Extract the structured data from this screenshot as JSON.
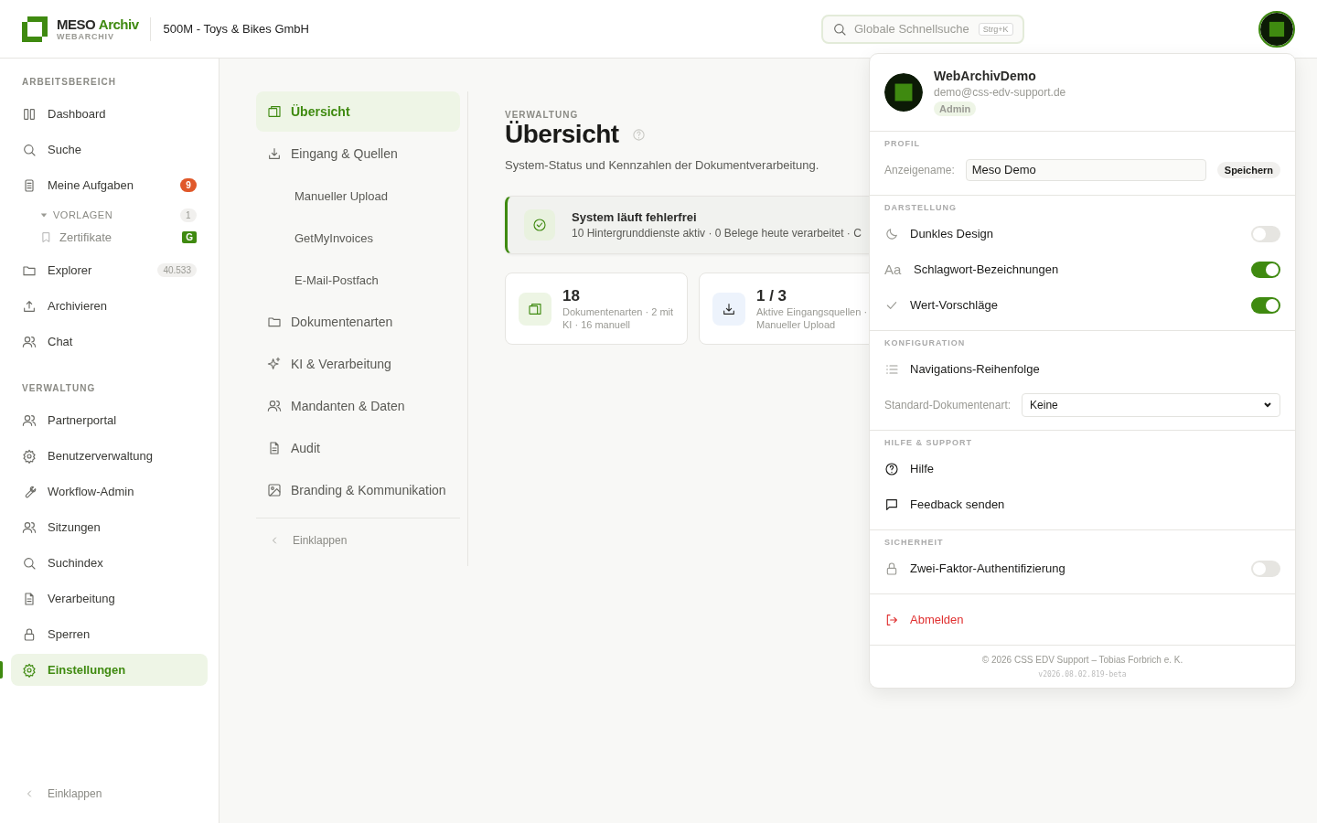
{
  "header": {
    "brand": {
      "primary": "MESO",
      "accent": "Archiv",
      "tagline": "WEBARCHIV"
    },
    "tenant": "500M - Toys & Bikes GmbH",
    "search": {
      "placeholder": "Globale Schnellsuche",
      "shortcut": "Strg+K"
    }
  },
  "sidebar": {
    "sections": [
      {
        "title": "ARBEITSBEREICH",
        "items": [
          {
            "label": "Dashboard",
            "selected": false
          },
          {
            "label": "Suche",
            "selected": false
          },
          {
            "label": "Meine Aufgaben",
            "selected": false,
            "badge": {
              "text": "9",
              "color": "#e0582a"
            },
            "children": [
              {
                "label": "VORLAGEN",
                "expanded": true,
                "badge": {
                  "text": "1",
                  "color": "#f1f0ee"
                },
                "children": [
                  {
                    "label": "Zertifikate",
                    "badge": {
                      "text": "G",
                      "color": "#3f8a10"
                    }
                  }
                ]
              }
            ]
          },
          {
            "label": "Explorer",
            "selected": false,
            "badge": {
              "text": "40.533",
              "color": "#f1f0ee"
            }
          },
          {
            "label": "Archivieren",
            "selected": false
          },
          {
            "label": "Chat",
            "selected": false
          }
        ]
      },
      {
        "title": "VERWALTUNG",
        "items": [
          {
            "label": "Partnerportal",
            "selected": false
          },
          {
            "label": "Benutzerverwaltung",
            "selected": false
          },
          {
            "label": "Workflow-Admin",
            "selected": false
          },
          {
            "label": "Sitzungen",
            "selected": false
          },
          {
            "label": "Suchindex",
            "selected": false
          },
          {
            "label": "Verarbeitung",
            "selected": false
          },
          {
            "label": "Sperren",
            "selected": false
          },
          {
            "label": "Einstellungen",
            "selected": true
          }
        ]
      }
    ],
    "collapse": "Einklappen"
  },
  "settings_nav": {
    "items": [
      {
        "label": "Übersicht",
        "selected": true
      },
      {
        "label": "Eingang & Quellen",
        "selected": false,
        "children": [
          {
            "label": "Manueller Upload",
            "selected": false
          },
          {
            "label": "GetMyInvoices",
            "selected": false
          },
          {
            "label": "E-Mail-Postfach",
            "selected": false
          }
        ]
      },
      {
        "label": "Dokumentenarten",
        "selected": false
      },
      {
        "label": "KI & Verarbeitung",
        "selected": false
      },
      {
        "label": "Mandanten & Daten",
        "selected": false
      },
      {
        "label": "Audit",
        "selected": false
      },
      {
        "label": "Branding & Kommunikation",
        "selected": false
      }
    ],
    "collapse": "Einklappen"
  },
  "main": {
    "eyebrow": "VERWALTUNG",
    "title": "Übersicht",
    "subtitle": "System-Status und Kennzahlen der Dokumentverarbeitung.",
    "status": {
      "title": "System läuft fehlerfrei",
      "text": "10 Hintergrunddienste aktiv · 0 Belege heute verarbeitet · C"
    },
    "stats": [
      {
        "value": "18",
        "text": "Dokumentenarten · 2 mit KI · 16 manuell",
        "color": "#edf5e4"
      },
      {
        "value": "1 / 3",
        "text": "Aktive Eingangsquellen · Manueller Upload",
        "color": "#edf3fc"
      }
    ]
  },
  "user_menu": {
    "name": "WebArchivDemo",
    "email": "demo@css-edv-support.de",
    "role": "Admin",
    "sections": [
      {
        "title": "PROFIL",
        "rows": [
          {
            "kind": "input",
            "label": "Anzeigename:",
            "value": "Meso Demo",
            "button": "Speichern"
          }
        ]
      },
      {
        "title": "DARSTELLUNG",
        "rows": [
          {
            "kind": "toggle",
            "label": "Dunkles Design",
            "on": false
          },
          {
            "kind": "toggle",
            "glyph": "Aa",
            "label": "Schlagwort-Bezeichnungen",
            "on": true
          },
          {
            "kind": "toggle",
            "label": "Wert-Vorschläge",
            "on": true
          }
        ]
      },
      {
        "title": "KONFIGURATION",
        "rows": [
          {
            "kind": "link",
            "label": "Navigations-Reihenfolge"
          },
          {
            "kind": "select",
            "label": "Standard-Dokumentenart:",
            "value": "Keine"
          }
        ]
      },
      {
        "title": "HILFE & SUPPORT",
        "rows": [
          {
            "kind": "link",
            "label": "Hilfe"
          },
          {
            "kind": "link",
            "label": "Feedback senden"
          }
        ]
      },
      {
        "title": "SICHERHEIT",
        "rows": [
          {
            "kind": "toggle",
            "label": "Zwei-Faktor-Authentifizierung",
            "on": false
          }
        ]
      },
      {
        "rows": [
          {
            "kind": "danger",
            "label": "Abmelden"
          }
        ]
      }
    ],
    "copyright": "© 2026 CSS EDV Support – Tobias Forbrich e. K.",
    "version": "v2026.08.02.819-beta"
  }
}
